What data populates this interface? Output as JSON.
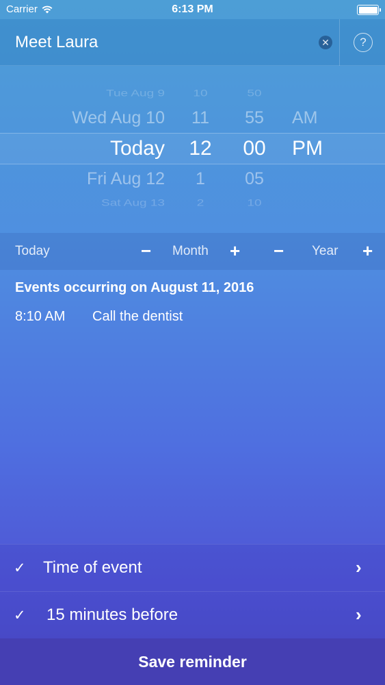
{
  "status_bar": {
    "carrier": "Carrier",
    "time": "6:13 PM"
  },
  "title_bar": {
    "value": "Meet Laura",
    "clear_icon": "clear-circle-icon",
    "help_icon": "question-circle-icon"
  },
  "picker": {
    "dates": [
      "Tue Aug 9",
      "Wed Aug 10",
      "Today",
      "Fri Aug 12",
      "Sat Aug 13"
    ],
    "hours": [
      "10",
      "11",
      "12",
      "1",
      "2"
    ],
    "minutes": [
      "50",
      "55",
      "00",
      "05",
      "10"
    ],
    "ampm": [
      "",
      "AM",
      "PM",
      "",
      ""
    ],
    "selected_index": 2
  },
  "nav": {
    "today": "Today",
    "month": "Month",
    "year": "Year",
    "minus": "−",
    "plus": "+"
  },
  "events": {
    "heading": "Events occurring on August 11, 2016",
    "items": [
      {
        "time": "8:10 AM",
        "title": "Call the dentist"
      }
    ]
  },
  "options": [
    {
      "label": "Time of event",
      "checked": true
    },
    {
      "label": "15 minutes before",
      "checked": true
    }
  ],
  "save_label": "Save reminder",
  "colors": {
    "gradient_top": "#4d9ed6",
    "gradient_bottom": "#4a48c0",
    "save_button": "#453fb3"
  }
}
